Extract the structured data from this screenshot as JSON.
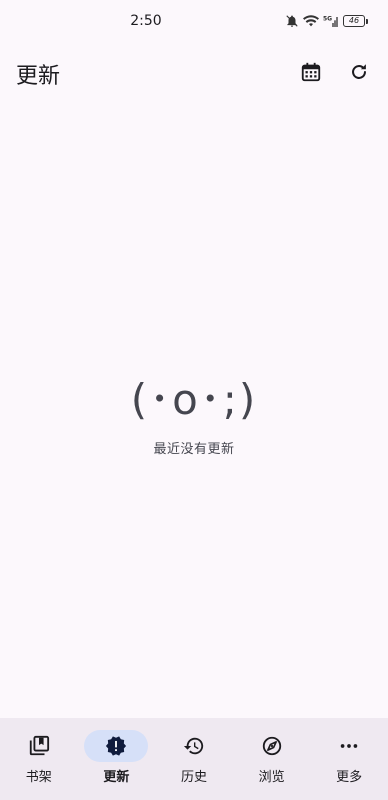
{
  "status_bar": {
    "time": "2:50",
    "battery": "46",
    "signal_label": "5G"
  },
  "app_bar": {
    "title": "更新",
    "actions": [
      {
        "icon": "calendar-icon"
      },
      {
        "icon": "refresh-icon"
      }
    ]
  },
  "empty_state": {
    "face": "(･o･;)",
    "message": "最近没有更新"
  },
  "bottom_nav": {
    "items": [
      {
        "label": "书架",
        "icon": "library-icon",
        "active": false
      },
      {
        "label": "更新",
        "icon": "new-releases-icon",
        "active": true
      },
      {
        "label": "历史",
        "icon": "history-icon",
        "active": false
      },
      {
        "label": "浏览",
        "icon": "explore-icon",
        "active": false
      },
      {
        "label": "更多",
        "icon": "more-icon",
        "active": false
      }
    ]
  },
  "colors": {
    "background": "#fcf8fc",
    "nav_background": "#efe9f1",
    "active_indicator": "#d6e0f8",
    "active_icon": "#0f1b3d"
  }
}
